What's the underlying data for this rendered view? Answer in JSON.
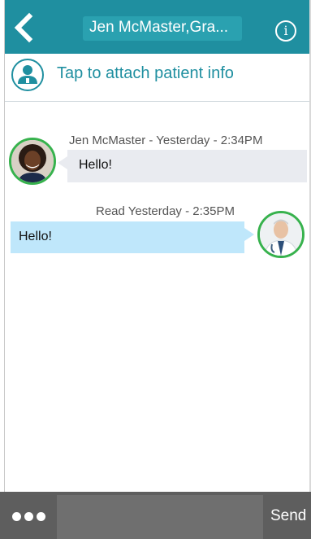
{
  "header": {
    "title": "Jen McMaster,Gra...",
    "back_icon": "chevron-left-icon",
    "info_icon": "info-icon",
    "info_glyph": "i",
    "background_color": "#1f8fa0"
  },
  "attach_bar": {
    "label": "Tap to attach patient info",
    "icon": "patient-icon",
    "accent_color": "#1f8fa0"
  },
  "messages": [
    {
      "direction": "incoming",
      "meta": "Jen McMaster - Yesterday - 2:34PM",
      "text": "Hello!",
      "avatar": "woman-avatar"
    },
    {
      "direction": "outgoing",
      "meta": "Read Yesterday - 2:35PM",
      "text": "Hello!",
      "avatar": "doctor-avatar"
    }
  ],
  "composer": {
    "more_icon": "more-dots-icon",
    "input_value": "",
    "input_placeholder": "",
    "send_label": "Send"
  },
  "colors": {
    "incoming_bubble": "#e9ebf0",
    "outgoing_bubble": "#bfe7fb",
    "avatar_ring": "#37b24d",
    "footer": "#5e5e5e"
  }
}
